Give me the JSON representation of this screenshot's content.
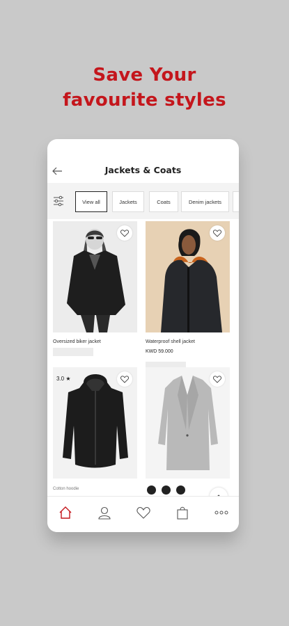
{
  "headline": {
    "line1": "Save Your",
    "line2": "favourite styles"
  },
  "header": {
    "title": "Jackets & Coats"
  },
  "filters": [
    {
      "label": "View all",
      "active": true
    },
    {
      "label": "Jackets",
      "active": false
    },
    {
      "label": "Coats",
      "active": false
    },
    {
      "label": "Denim jackets",
      "active": false
    }
  ],
  "products": [
    {
      "name": "Oversized biker jacket",
      "price": ""
    },
    {
      "name": "Waterproof shell jacket",
      "price": "KWD 59.000"
    },
    {
      "name": "Cotton hoodie",
      "price": "",
      "rating": "3.0 ★"
    },
    {
      "name": "",
      "price": ""
    }
  ],
  "bottom_nav": [
    "home-icon",
    "account-icon",
    "favourites-icon",
    "bag-icon",
    "more-icon"
  ],
  "colors": {
    "brand_red": "#c4161c",
    "background": "#c9c9c9"
  }
}
